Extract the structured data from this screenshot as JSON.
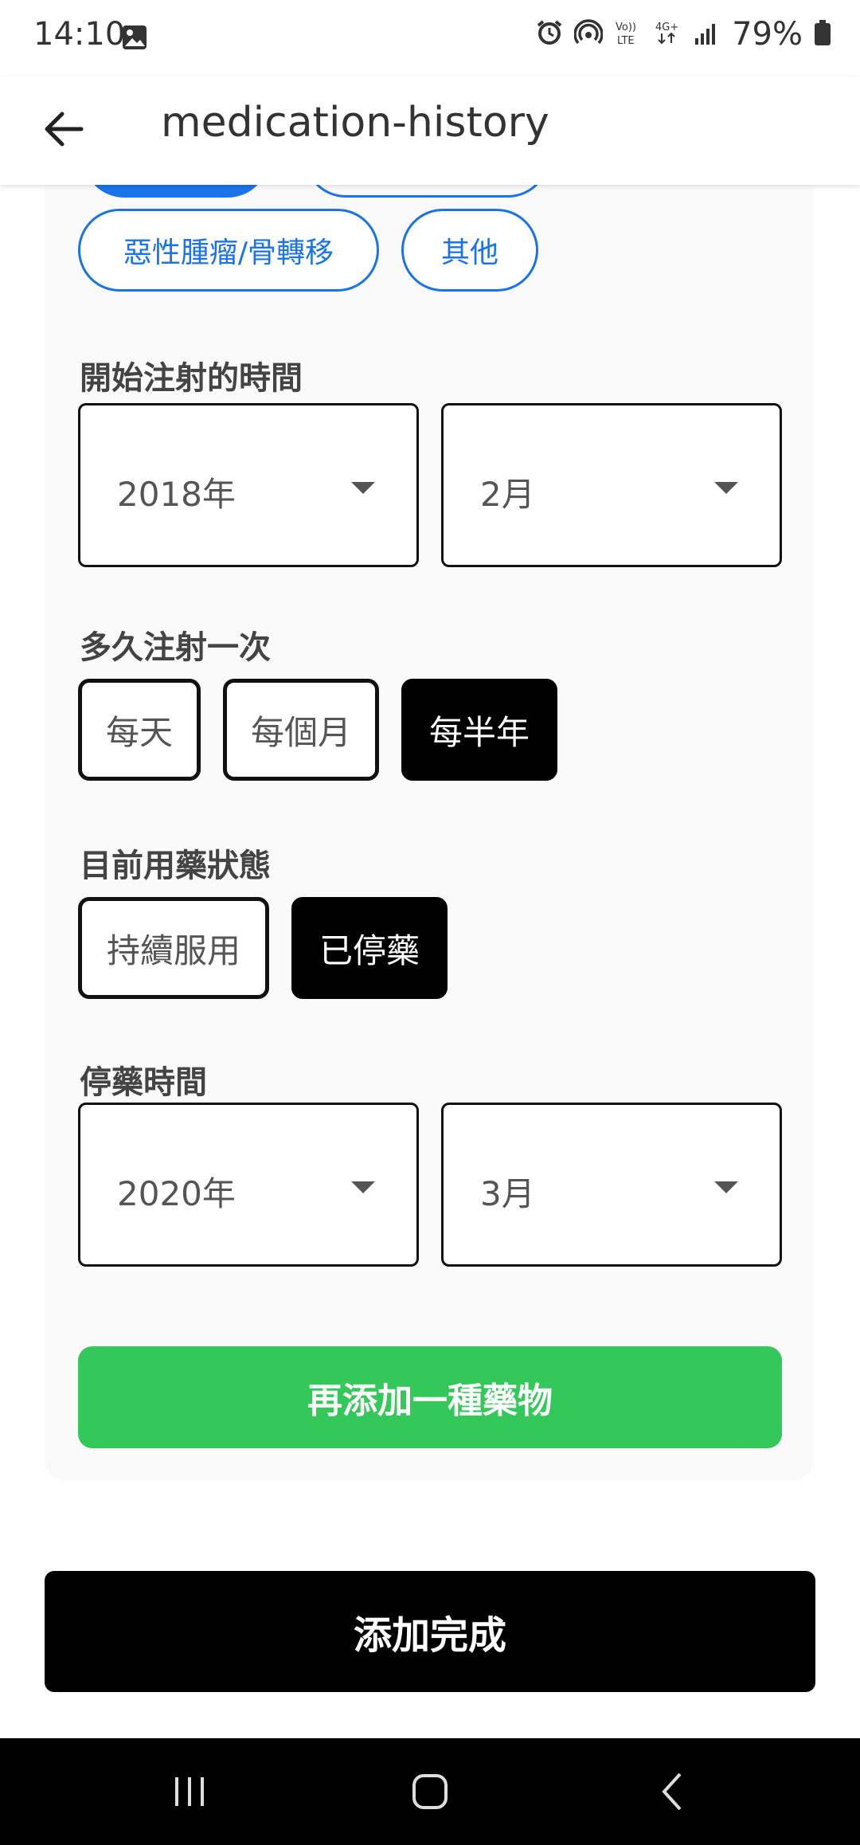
{
  "status_bar": {
    "time": "14:10",
    "battery": "79%",
    "icons": [
      "image-icon",
      "alarm-icon",
      "hotspot-icon",
      "volte-icon",
      "4g-icon",
      "signal-icon",
      "battery-icon"
    ]
  },
  "app_bar": {
    "title": "medication-history",
    "back_icon": "back-arrow-icon"
  },
  "indications": {
    "options": [
      {
        "label": "惡性腫瘤/骨轉移",
        "selected": false
      },
      {
        "label": "其他",
        "selected": false
      }
    ]
  },
  "start_time": {
    "label": "開始注射的時間",
    "year": "2018年",
    "month": "2月"
  },
  "frequency": {
    "label": "多久注射一次",
    "options": [
      {
        "label": "每天",
        "selected": false
      },
      {
        "label": "每個月",
        "selected": false
      },
      {
        "label": "每半年",
        "selected": true
      }
    ]
  },
  "status": {
    "label": "目前用藥狀態",
    "options": [
      {
        "label": "持續服用",
        "selected": false
      },
      {
        "label": "已停藥",
        "selected": true
      }
    ]
  },
  "stop_time": {
    "label": "停藥時間",
    "year": "2020年",
    "month": "3月"
  },
  "buttons": {
    "add_another": "再添加一種藥物",
    "done": "添加完成"
  },
  "colors": {
    "accent_blue": "#1a73e8",
    "green": "#34c759",
    "black": "#000000"
  }
}
